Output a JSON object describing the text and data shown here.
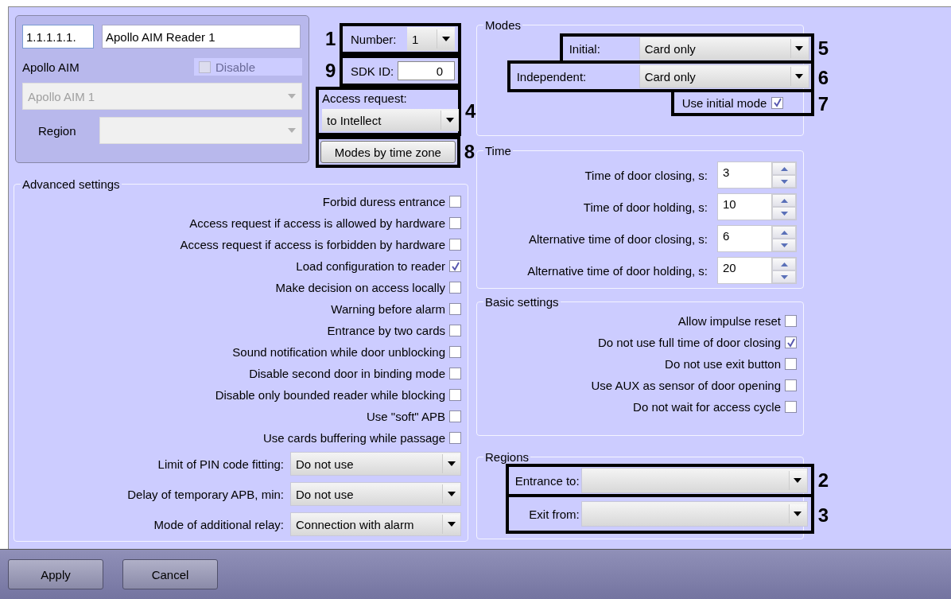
{
  "device": {
    "address": "1.1.1.1.1.",
    "name": "Apollo AIM Reader 1",
    "type_label": "Apollo AIM",
    "disable": {
      "label": "Disable",
      "checked": false,
      "disabled": true
    },
    "parent": {
      "value": "Apollo AIM 1",
      "disabled": true
    },
    "region": {
      "label": "Region",
      "disabled": true
    }
  },
  "number": {
    "label": "Number:",
    "value": "1",
    "callout": "1"
  },
  "sdk_id": {
    "label": "SDK ID:",
    "value": "0",
    "callout": "9"
  },
  "access_request": {
    "label": "Access request:",
    "value": "to Intellect",
    "callout": "4"
  },
  "modes_button": {
    "label": "Modes by time zone",
    "callout": "8"
  },
  "advanced_settings": {
    "title": "Advanced settings",
    "checkboxes": [
      {
        "label": "Forbid duress entrance",
        "checked": false
      },
      {
        "label": "Access request if access is allowed by hardware",
        "checked": false
      },
      {
        "label": "Access request if access is forbidden by hardware",
        "checked": false
      },
      {
        "label": "Load configuration to reader",
        "checked": true
      },
      {
        "label": "Make decision on access locally",
        "checked": false
      },
      {
        "label": "Warning before alarm",
        "checked": false
      },
      {
        "label": "Entrance by two cards",
        "checked": false
      },
      {
        "label": "Sound notification while door unblocking",
        "checked": false
      },
      {
        "label": "Disable second door in binding mode",
        "checked": false
      },
      {
        "label": "Disable only bounded reader while blocking",
        "checked": false
      },
      {
        "label": "Use \"soft\" APB",
        "checked": false
      },
      {
        "label": "Use cards buffering while passage",
        "checked": false
      }
    ],
    "selects": [
      {
        "label": "Limit of PIN code fitting:",
        "value": "Do not use"
      },
      {
        "label": "Delay of temporary APB, min:",
        "value": "Do not use"
      },
      {
        "label": "Mode of additional relay:",
        "value": "Connection with alarm"
      }
    ]
  },
  "modes": {
    "title": "Modes",
    "initial": {
      "label": "Initial:",
      "value": "Card only",
      "callout": "5"
    },
    "independent": {
      "label": "Independent:",
      "value": "Card only",
      "callout": "6"
    },
    "use_initial_mode": {
      "label": "Use initial mode",
      "checked": true,
      "callout": "7"
    }
  },
  "time": {
    "title": "Time",
    "fields": [
      {
        "label": "Time of door closing, s:",
        "value": "3"
      },
      {
        "label": "Time of door holding, s:",
        "value": "10"
      },
      {
        "label": "Alternative time of door closing, s:",
        "value": "6"
      },
      {
        "label": "Alternative time of door holding, s:",
        "value": "20"
      }
    ]
  },
  "basic_settings": {
    "title": "Basic settings",
    "checkboxes": [
      {
        "label": "Allow impulse reset",
        "checked": false
      },
      {
        "label": "Do not use full time of door closing",
        "checked": true
      },
      {
        "label": "Do not use exit button",
        "checked": false
      },
      {
        "label": "Use AUX as sensor of door opening",
        "checked": false
      },
      {
        "label": "Do not wait for access cycle",
        "checked": false
      }
    ]
  },
  "regions": {
    "title": "Regions",
    "fields": [
      {
        "label": "Entrance to:",
        "callout": "2"
      },
      {
        "label": "Exit from:",
        "callout": "3"
      }
    ]
  },
  "buttons": [
    {
      "label": "Apply"
    },
    {
      "label": "Cancel"
    }
  ]
}
